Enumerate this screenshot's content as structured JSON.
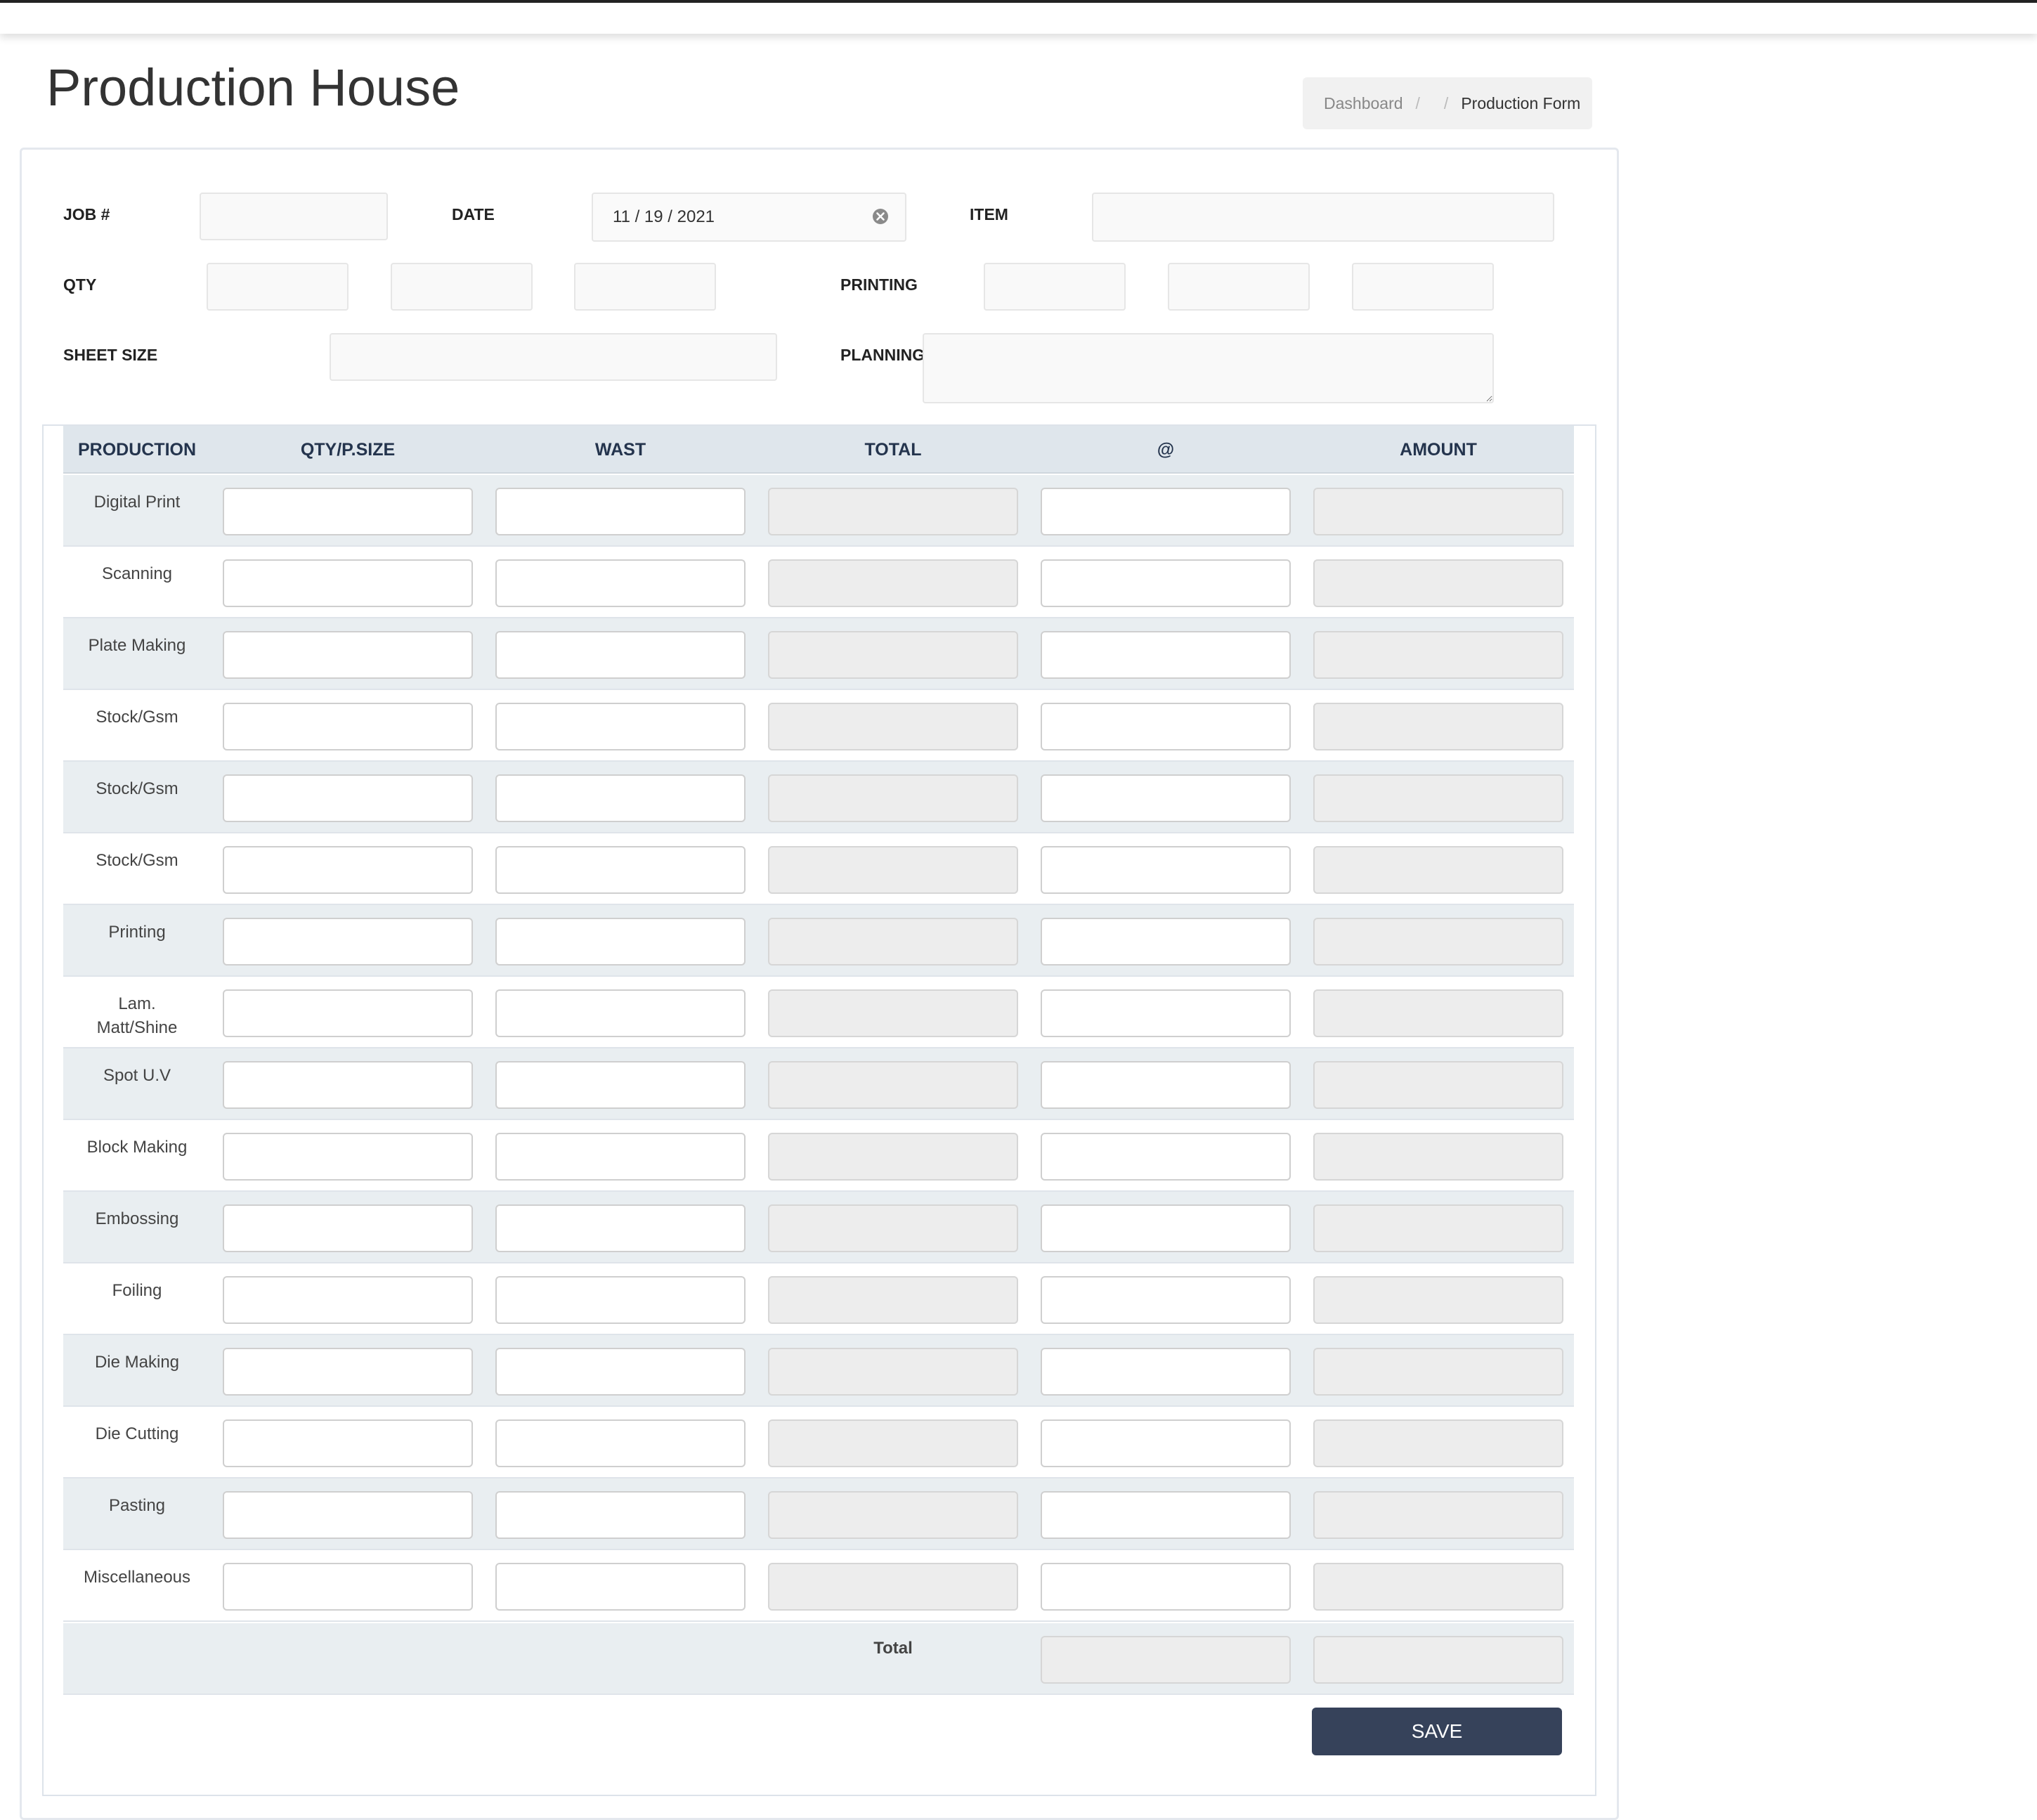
{
  "header": {
    "title": "Production House",
    "breadcrumb": {
      "home": "Dashboard",
      "separator": "/",
      "current": "Production Form"
    }
  },
  "form": {
    "job_label": "JOB #",
    "date_label": "DATE",
    "date_value": "11 / 19 / 2021",
    "item_label": "ITEM",
    "qty_label": "QTY",
    "printing_label": "PRINTING",
    "sheet_size_label": "SHEET SIZE",
    "planning_label": "PLANNING"
  },
  "table": {
    "headers": [
      "PRODUCTION",
      "QTY/P.SIZE",
      "WAST",
      "TOTAL",
      "@",
      "AMOUNT"
    ],
    "rows": [
      "Digital Print",
      "Scanning",
      "Plate Making",
      "Stock/Gsm",
      "Stock/Gsm",
      "Stock/Gsm",
      "Printing",
      "Lam.\nMatt/Shine",
      "Spot U.V",
      "Block Making",
      "Embossing",
      "Foiling",
      "Die Making",
      "Die Cutting",
      "Pasting",
      "Miscellaneous"
    ],
    "total_label": "Total"
  },
  "actions": {
    "save_label": "SAVE"
  },
  "colors": {
    "header_bg": "#dfe6ec",
    "stripe_bg": "#e9eef1",
    "save_button_bg": "#36425a",
    "header_text": "#24344d"
  },
  "icons": {
    "date_clear": "clear-circle-icon"
  }
}
